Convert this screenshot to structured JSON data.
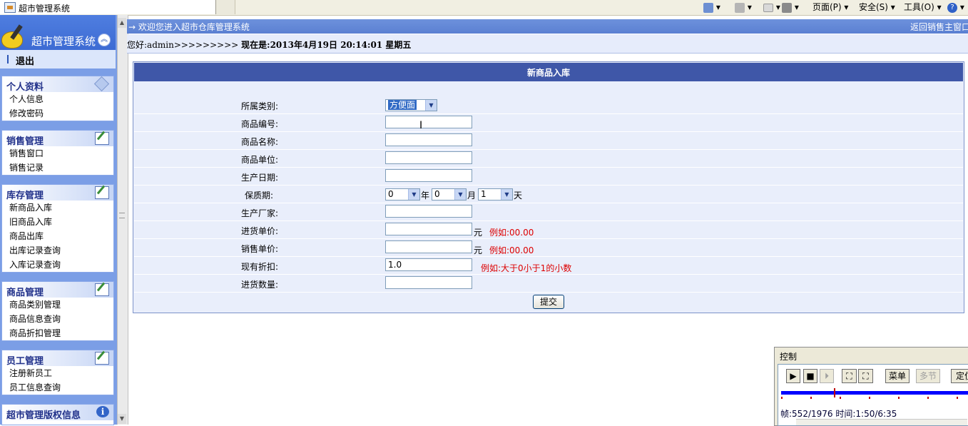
{
  "browser": {
    "tab_title": "超市管理系统",
    "toolbar": {
      "page": "页面(P)",
      "safety": "安全(S)",
      "tools": "工具(O)"
    }
  },
  "sidebar": {
    "title": "超市管理系统",
    "logout": "退出",
    "groups": [
      {
        "title": "个人资料",
        "items": [
          "个人信息",
          "修改密码"
        ]
      },
      {
        "title": "销售管理",
        "items": [
          "销售窗口",
          "销售记录"
        ]
      },
      {
        "title": "库存管理",
        "items": [
          "新商品入库",
          "旧商品入库",
          "商品出库",
          "出库记录查询",
          "入库记录查询"
        ]
      },
      {
        "title": "商品管理",
        "items": [
          "商品类别管理",
          "商品信息查询",
          "商品折扣管理"
        ]
      },
      {
        "title": "员工管理",
        "items": [
          "注册新员工",
          "员工信息查询"
        ]
      },
      {
        "title": "超市管理版权信息",
        "items": []
      }
    ]
  },
  "header": {
    "welcome": "→ 欢迎您进入超市仓库管理系统",
    "return_link": "返回销售主窗口",
    "greeting": "您好:admin>>>>>>>>> ",
    "now_label": "现在是:2013年4月19日  20:14:01 星期五"
  },
  "form": {
    "title": "新商品入库",
    "labels": {
      "category": "所属类别:",
      "code": "商品编号:",
      "name": "商品名称:",
      "unit": "商品单位:",
      "production_date": "生产日期:",
      "shelf_life": "保质期:",
      "manufacturer": "生产厂家:",
      "purchase_price": "进货单价:",
      "sale_price": "销售单价:",
      "discount": "现有折扣:",
      "quantity": "进货数量:"
    },
    "category_value": "方便面",
    "shelf_life": {
      "year": "0",
      "year_unit": "年",
      "month": "0",
      "month_unit": "月",
      "day": "1",
      "day_unit": "天"
    },
    "currency_unit": "元",
    "price_hint": "例如:00.00",
    "discount_value": "1.0",
    "discount_hint": "例如:大于0小于1的小数",
    "submit": "提交"
  },
  "control": {
    "title": "控制",
    "menu": "菜单",
    "multi": "多节",
    "locate": "定位",
    "status": "帧:552/1976 时间:1:50/6:35"
  }
}
